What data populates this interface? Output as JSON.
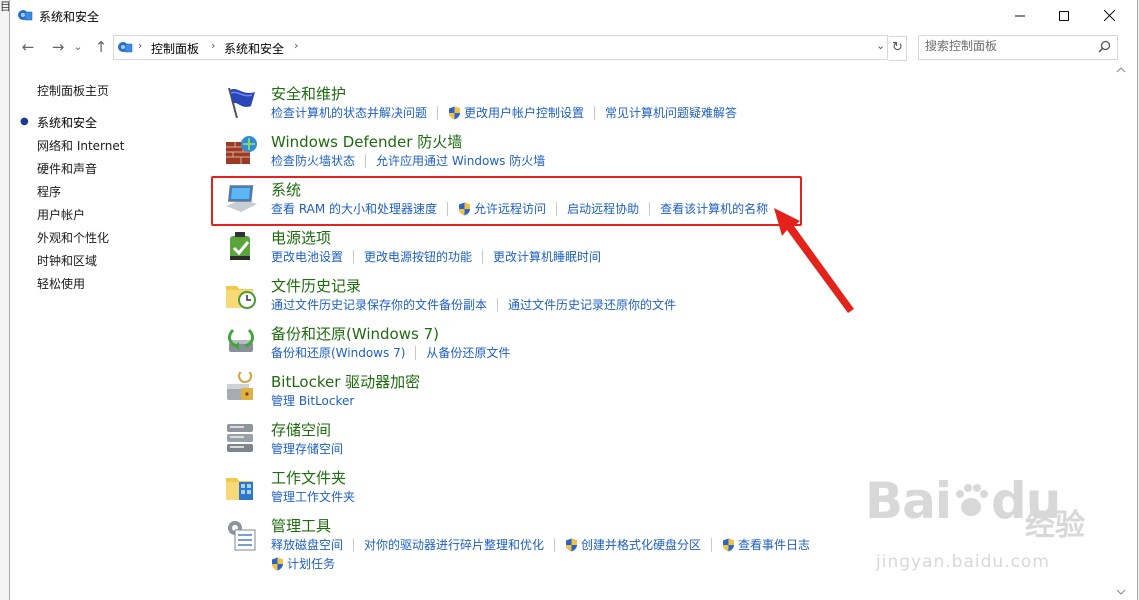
{
  "window": {
    "title": "系统和安全",
    "side_glyph": "目"
  },
  "nav": {
    "back": "←",
    "forward": "→",
    "recent": "⌄",
    "up": "↑",
    "crumbs": [
      "控制面板",
      "系统和安全"
    ],
    "crumb_sep": "›",
    "dropdown": "⌄",
    "refresh": "↻"
  },
  "search": {
    "placeholder": "搜索控制面板",
    "icon": "search-icon"
  },
  "left": {
    "home": "控制面板主页",
    "items": [
      "系统和安全",
      "网络和 Internet",
      "硬件和声音",
      "程序",
      "用户帐户",
      "外观和个性化",
      "时钟和区域",
      "轻松使用"
    ],
    "current_index": 0,
    "bullet": "●"
  },
  "categories": [
    {
      "title": "安全和维护",
      "icon": "flag-icon",
      "links": [
        {
          "text": "检查计算机的状态并解决问题",
          "shield": false
        },
        {
          "text": "更改用户帐户控制设置",
          "shield": true
        },
        {
          "text": "常见计算机问题疑难解答",
          "shield": false
        }
      ]
    },
    {
      "title": "Windows Defender 防火墙",
      "icon": "firewall-icon",
      "links": [
        {
          "text": "检查防火墙状态",
          "shield": false
        },
        {
          "text": "允许应用通过 Windows 防火墙",
          "shield": false
        }
      ]
    },
    {
      "title": "系统",
      "icon": "computer-icon",
      "links": [
        {
          "text": "查看 RAM 的大小和处理器速度",
          "shield": false
        },
        {
          "text": "允许远程访问",
          "shield": true
        },
        {
          "text": "启动远程协助",
          "shield": false
        },
        {
          "text": "查看该计算机的名称",
          "shield": false
        }
      ]
    },
    {
      "title": "电源选项",
      "icon": "power-options-icon",
      "links": [
        {
          "text": "更改电池设置",
          "shield": false
        },
        {
          "text": "更改电源按钮的功能",
          "shield": false
        },
        {
          "text": "更改计算机睡眠时间",
          "shield": false
        }
      ]
    },
    {
      "title": "文件历史记录",
      "icon": "file-history-icon",
      "links": [
        {
          "text": "通过文件历史记录保存你的文件备份副本",
          "shield": false
        },
        {
          "text": "通过文件历史记录还原你的文件",
          "shield": false
        }
      ]
    },
    {
      "title": "备份和还原(Windows 7)",
      "icon": "backup-icon",
      "links": [
        {
          "text": "备份和还原(Windows 7)",
          "shield": false
        },
        {
          "text": "从备份还原文件",
          "shield": false
        }
      ]
    },
    {
      "title": "BitLocker 驱动器加密",
      "icon": "bitlocker-icon",
      "links": [
        {
          "text": "管理 BitLocker",
          "shield": false
        }
      ]
    },
    {
      "title": "存储空间",
      "icon": "storage-spaces-icon",
      "links": [
        {
          "text": "管理存储空间",
          "shield": false
        }
      ]
    },
    {
      "title": "工作文件夹",
      "icon": "work-folders-icon",
      "links": [
        {
          "text": "管理工作文件夹",
          "shield": false
        }
      ]
    },
    {
      "title": "管理工具",
      "icon": "admin-tools-icon",
      "links": [
        {
          "text": "释放磁盘空间",
          "shield": false
        },
        {
          "text": "对你的驱动器进行碎片整理和优化",
          "shield": false
        },
        {
          "text": "创建并格式化硬盘分区",
          "shield": true
        },
        {
          "text": "查看事件日志",
          "shield": true
        }
      ],
      "links2": [
        {
          "text": "计划任务",
          "shield": true
        }
      ]
    }
  ],
  "watermark": {
    "brand": "Bai",
    "brand2": "du",
    "cn": "经验",
    "url": "jingyan.baidu.com"
  },
  "colors": {
    "title_green": "#1e6c0e",
    "link_blue": "#1e5fc4",
    "highlight_red": "#e3231b"
  }
}
